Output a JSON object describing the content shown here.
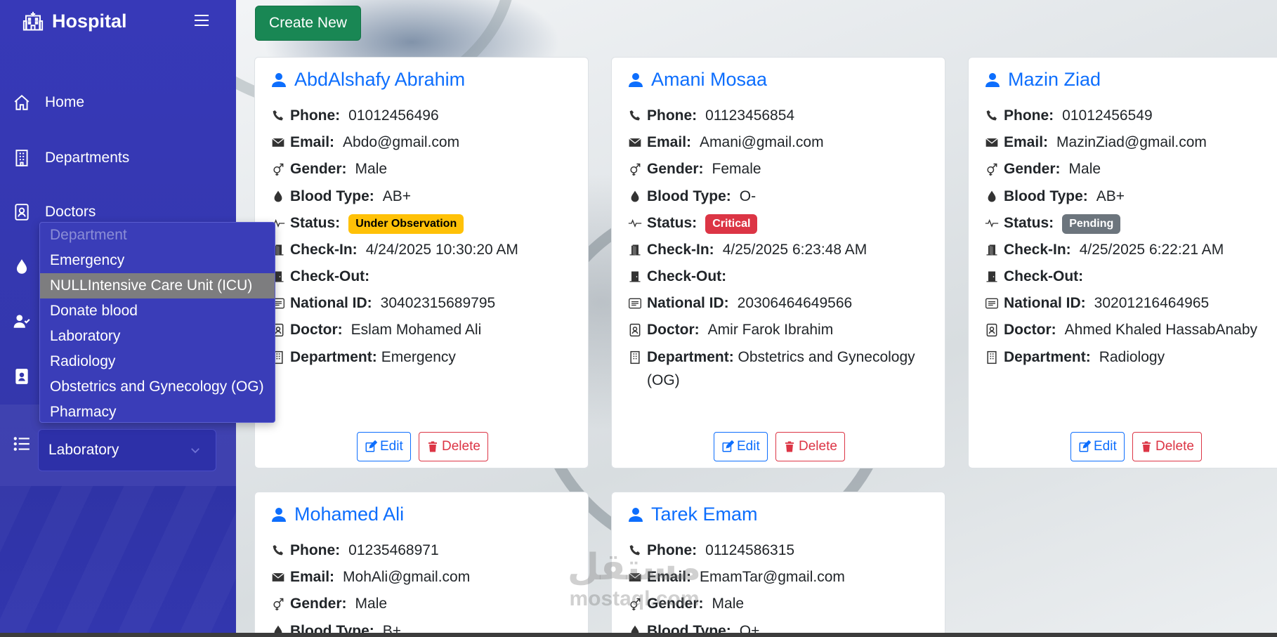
{
  "sidebar": {
    "brand": "Hospital",
    "nav": [
      {
        "label": "Home",
        "icon": "home-icon"
      },
      {
        "label": "Departments",
        "icon": "building-icon"
      },
      {
        "label": "Doctors",
        "icon": "id-badge-icon"
      }
    ],
    "department_select": {
      "value": "Laboratory",
      "options": [
        {
          "label": "Department",
          "disabled": true
        },
        {
          "label": "Emergency"
        },
        {
          "label": "NULLIntensive Care Unit (ICU)",
          "highlighted": true
        },
        {
          "label": "Donate blood"
        },
        {
          "label": "Laboratory"
        },
        {
          "label": "Radiology"
        },
        {
          "label": "Obstetrics and Gynecology (OG)"
        },
        {
          "label": "Pharmacy"
        }
      ]
    }
  },
  "toolbar": {
    "create_label": "Create New"
  },
  "labels": {
    "phone": "Phone:",
    "email": "Email:",
    "gender": "Gender:",
    "blood": "Blood Type:",
    "status": "Status:",
    "checkin": "Check-In:",
    "checkout": "Check-Out:",
    "national_id": "National ID:",
    "doctor": "Doctor:",
    "department": "Department:",
    "edit": "Edit",
    "delete": "Delete"
  },
  "patients": [
    {
      "name": "AbdAlshafy Abrahim",
      "phone": "01012456496",
      "email": "Abdo@gmail.com",
      "gender": "Male",
      "blood": "AB+",
      "status": "Under Observation",
      "checkin": "4/24/2025 10:30:20 AM",
      "checkout": "",
      "national_id": "30402315689795",
      "doctor": "Eslam Mohamed Ali",
      "department": "Emergency"
    },
    {
      "name": "Amani Mosaa",
      "phone": "01123456854",
      "email": "Amani@gmail.com",
      "gender": "Female",
      "blood": "O-",
      "status": "Critical",
      "checkin": "4/25/2025 6:23:48 AM",
      "checkout": "",
      "national_id": "20306464649566",
      "doctor": "Amir Farok Ibrahim",
      "department": "Obstetrics and Gynecology (OG)"
    },
    {
      "name": "Mazin Ziad",
      "phone": "01012456549",
      "email": "MazinZiad@gmail.com",
      "gender": "Male",
      "blood": "AB+",
      "status": "Pending",
      "checkin": "4/25/2025 6:22:21 AM",
      "checkout": "",
      "national_id": "30201216464965",
      "doctor": "Ahmed Khaled HassabAnaby",
      "department": "Radiology"
    },
    {
      "name": "Mohamed Ali",
      "phone": "01235468971",
      "email": "MohAli@gmail.com",
      "gender": "Male",
      "blood": "B+"
    },
    {
      "name": "Tarek Emam",
      "phone": "01124586315",
      "email": "EmamTar@gmail.com",
      "gender": "Male",
      "blood": "O+"
    }
  ],
  "watermark": {
    "arabic": "مستقل",
    "latin": "mostaql.com"
  },
  "colors": {
    "sidebar": "#3739b8",
    "primary": "#0d6efd",
    "success": "#198754",
    "danger": "#dc3545",
    "warning": "#ffc107",
    "secondary": "#6c757d"
  }
}
